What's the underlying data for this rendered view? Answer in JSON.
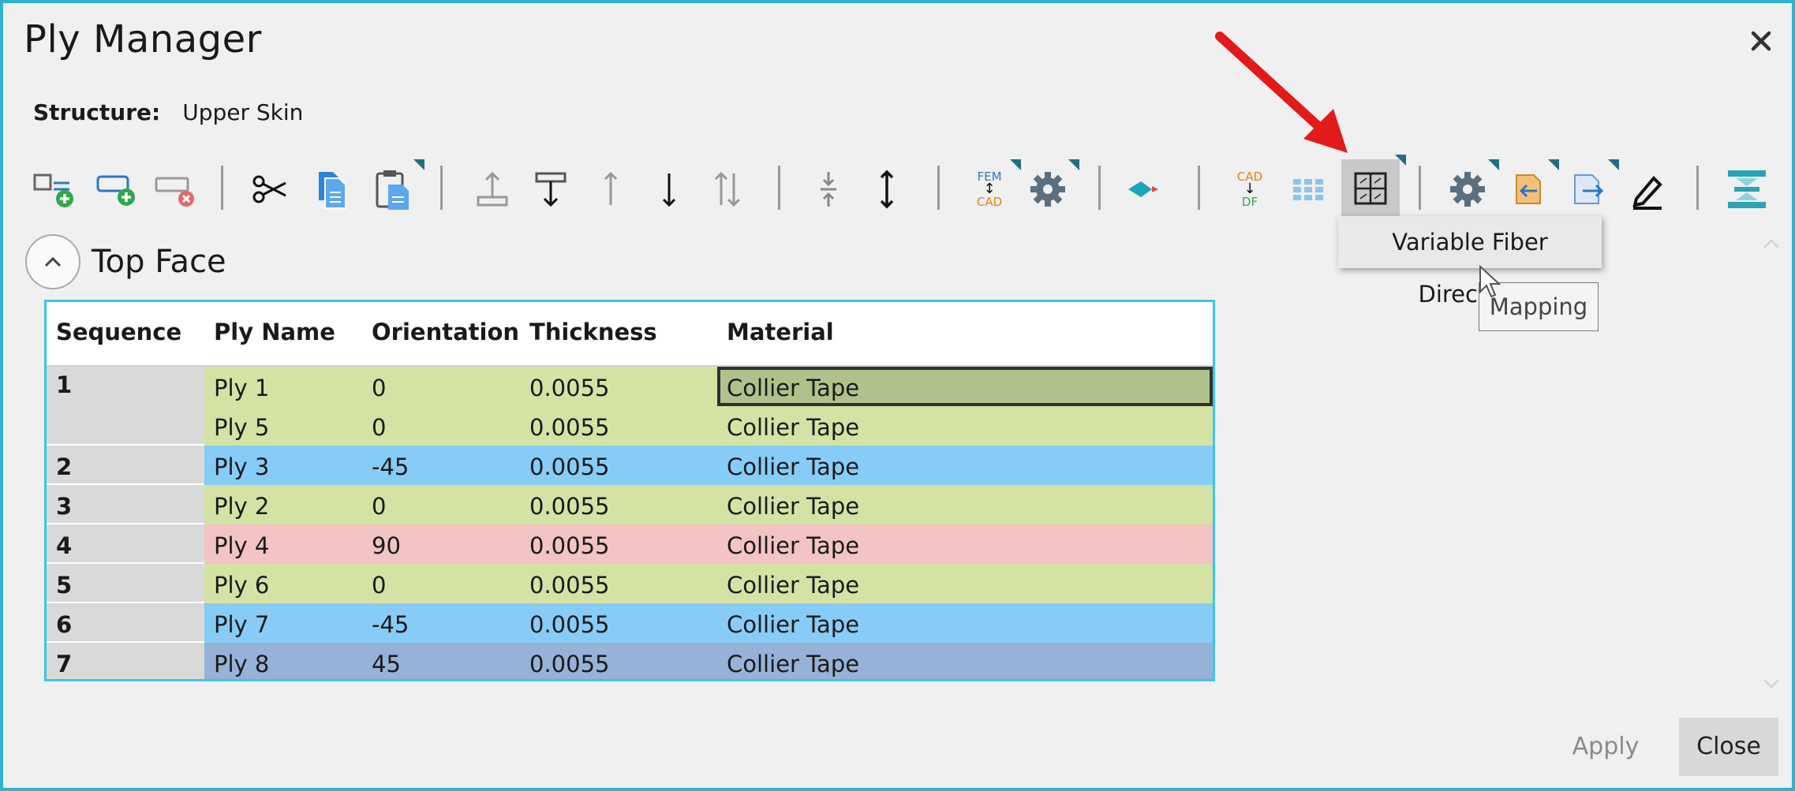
{
  "window": {
    "title": "Ply Manager"
  },
  "structure": {
    "label": "Structure:",
    "value": "Upper Skin"
  },
  "toolbar": {
    "icons": [
      "add-ply-icon",
      "add-group-icon",
      "remove-icon",
      "cut-icon",
      "copy-icon",
      "paste-icon",
      "move-top-icon",
      "move-bottom-icon",
      "move-up-icon",
      "move-down-icon",
      "sort-icon",
      "collapse-icon",
      "expand-icon",
      "fem-cad-icon",
      "gear-icon",
      "layer-icon",
      "cad-df-icon",
      "grid-icon",
      "variable-fiber-direction-icon",
      "settings-icon",
      "import-icon",
      "export-icon",
      "edit-icon",
      "stack-icon"
    ],
    "fem_top": "FEM",
    "fem_bottom": "CAD",
    "cad_top": "CAD",
    "cad_bottom": "DF"
  },
  "tooltip": {
    "primary": "Variable Fiber Direction",
    "secondary": "Mapping"
  },
  "section": {
    "title": "Top Face"
  },
  "table": {
    "headers": [
      "Sequence",
      "Ply Name",
      "Orientation",
      "Thickness",
      "Material"
    ],
    "rows": [
      {
        "seq": "1",
        "name": "Ply 1",
        "orientation": "0",
        "thickness": "0.0055",
        "material": "Collier Tape"
      },
      {
        "seq": "",
        "name": "Ply 5",
        "orientation": "0",
        "thickness": "0.0055",
        "material": "Collier Tape"
      },
      {
        "seq": "2",
        "name": "Ply 3",
        "orientation": "-45",
        "thickness": "0.0055",
        "material": "Collier Tape"
      },
      {
        "seq": "3",
        "name": "Ply 2",
        "orientation": "0",
        "thickness": "0.0055",
        "material": "Collier Tape"
      },
      {
        "seq": "4",
        "name": "Ply 4",
        "orientation": "90",
        "thickness": "0.0055",
        "material": "Collier Tape"
      },
      {
        "seq": "5",
        "name": "Ply 6",
        "orientation": "0",
        "thickness": "0.0055",
        "material": "Collier Tape"
      },
      {
        "seq": "6",
        "name": "Ply 7",
        "orientation": "-45",
        "thickness": "0.0055",
        "material": "Collier Tape"
      },
      {
        "seq": "7",
        "name": "Ply 8",
        "orientation": "45",
        "thickness": "0.0055",
        "material": "Collier Tape"
      }
    ]
  },
  "colors": {
    "ply_0": "#d4e3a4",
    "ply_m45": "#87ccf6",
    "ply_90": "#f2c4c4",
    "ply_45": "#96b2d6",
    "accent": "#2fb3c8"
  },
  "buttons": {
    "apply": "Apply",
    "close": "Close"
  }
}
